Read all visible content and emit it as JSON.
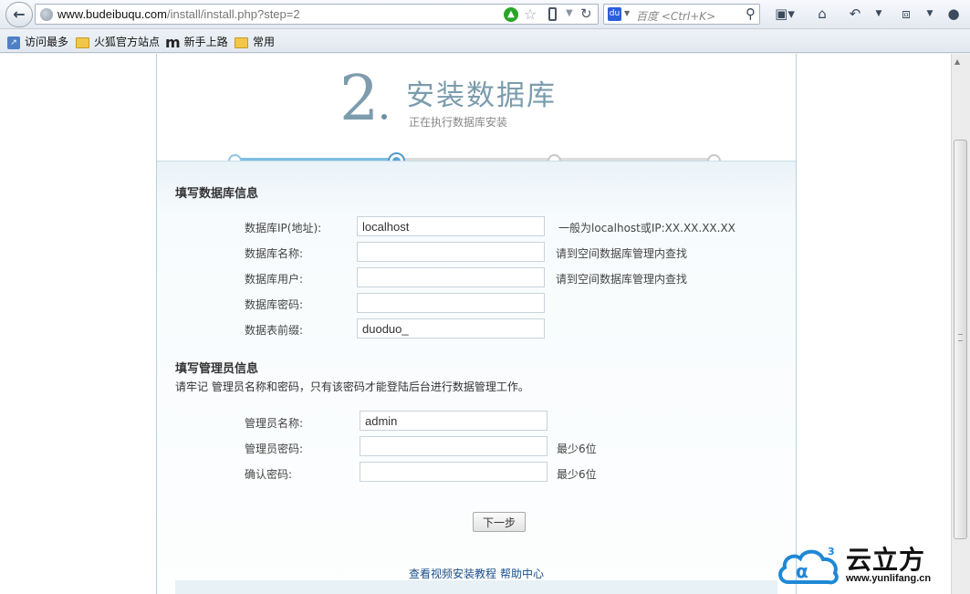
{
  "browser": {
    "url_host": "www.budeibuqu.com",
    "url_path": "/install/install.php?step=2",
    "search_placeholder": "百度 <Ctrl+K>",
    "search_engine_letter": "du",
    "bookmarks": [
      "访问最多",
      "火狐官方站点",
      "新手上路",
      "常用"
    ],
    "bookmark_m_glyph": "m"
  },
  "installer": {
    "step_number": "2",
    "title": "安装数据库",
    "subtitle": "正在执行数据库安装",
    "progress": {
      "current_step": 2,
      "total_steps": 4
    },
    "db_section": {
      "title": "填写数据库信息",
      "fields": [
        {
          "label": "数据库IP(地址):",
          "value": "localhost",
          "hint": "一般为localhost或IP:XX.XX.XX.XX"
        },
        {
          "label": "数据库名称:",
          "value": "",
          "hint": "请到空间数据库管理内查找"
        },
        {
          "label": "数据库用户:",
          "value": "",
          "hint": "请到空间数据库管理内查找"
        },
        {
          "label": "数据库密码:",
          "value": "",
          "hint": ""
        },
        {
          "label": "数据表前缀:",
          "value": "duoduo_",
          "hint": ""
        }
      ]
    },
    "admin_section": {
      "title": "填写管理员信息",
      "note": "请牢记 管理员名称和密码，只有该密码才能登陆后台进行数据管理工作。",
      "fields": [
        {
          "label": "管理员名称:",
          "value": "admin",
          "hint": ""
        },
        {
          "label": "管理员密码:",
          "value": "",
          "hint": "最少6位"
        },
        {
          "label": "确认密码:",
          "value": "",
          "hint": "最少6位"
        }
      ]
    },
    "next_button": "下一步",
    "footer_links": [
      "查看视频安装教程",
      "帮助中心"
    ]
  },
  "watermark": {
    "brand_cn": "云立方",
    "brand_url": "www.yunlifang.cn",
    "superscript": "3"
  },
  "colors": {
    "accent": "#7d9cae",
    "progress_fill": "#7fbde0",
    "progress_inactive": "#dcdcdc",
    "link": "#1a4f8a",
    "logo_blue": "#1e88d6"
  }
}
